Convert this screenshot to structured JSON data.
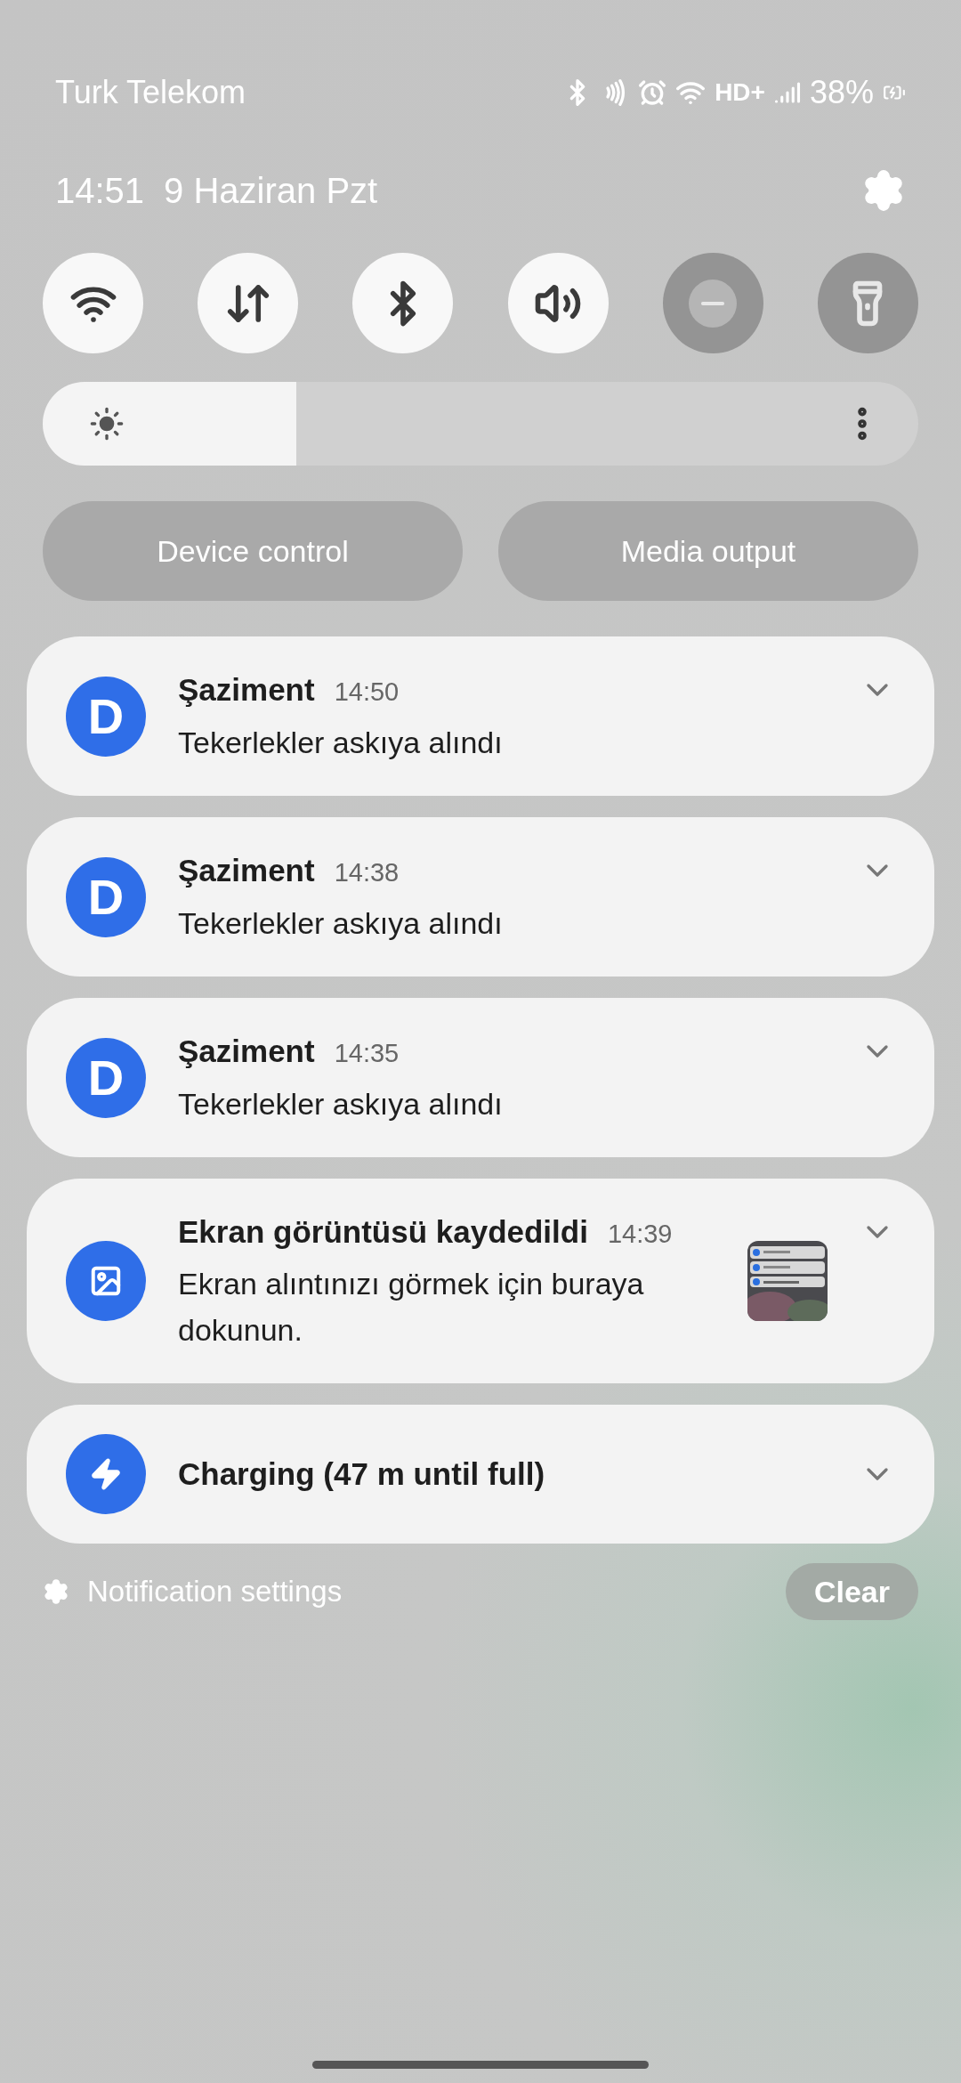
{
  "status_bar": {
    "carrier": "Turk Telekom",
    "network_label": "HD+",
    "battery": "38%"
  },
  "header": {
    "time": "14:51",
    "date": "9 Haziran Pzt"
  },
  "quick_toggles": [
    {
      "kind": "wifi",
      "on": true
    },
    {
      "kind": "data",
      "on": true
    },
    {
      "kind": "bluetooth",
      "on": true
    },
    {
      "kind": "sound",
      "on": true
    },
    {
      "kind": "dnd",
      "on": false
    },
    {
      "kind": "flashlight",
      "on": false
    }
  ],
  "brightness": {
    "level": 0.29
  },
  "buttons": [
    "Device control",
    "Media output"
  ],
  "notifications": [
    {
      "kind": "app",
      "icon_letter": "D",
      "title": "Şaziment",
      "time": "14:50",
      "text": "Tekerlekler askıya alındı"
    },
    {
      "kind": "app",
      "icon_letter": "D",
      "title": "Şaziment",
      "time": "14:38",
      "text": "Tekerlekler askıya alındı"
    },
    {
      "kind": "app",
      "icon_letter": "D",
      "title": "Şaziment",
      "time": "14:35",
      "text": "Tekerlekler askıya alındı"
    },
    {
      "kind": "screenshot",
      "title": "Ekran görüntüsü kaydedildi",
      "time": "14:39",
      "text": "Ekran alıntınızı görmek için buraya dokunun."
    },
    {
      "kind": "charging",
      "title": "Charging (47 m until full)"
    }
  ],
  "footer": {
    "settings_label": "Notification settings",
    "clear_label": "Clear"
  }
}
